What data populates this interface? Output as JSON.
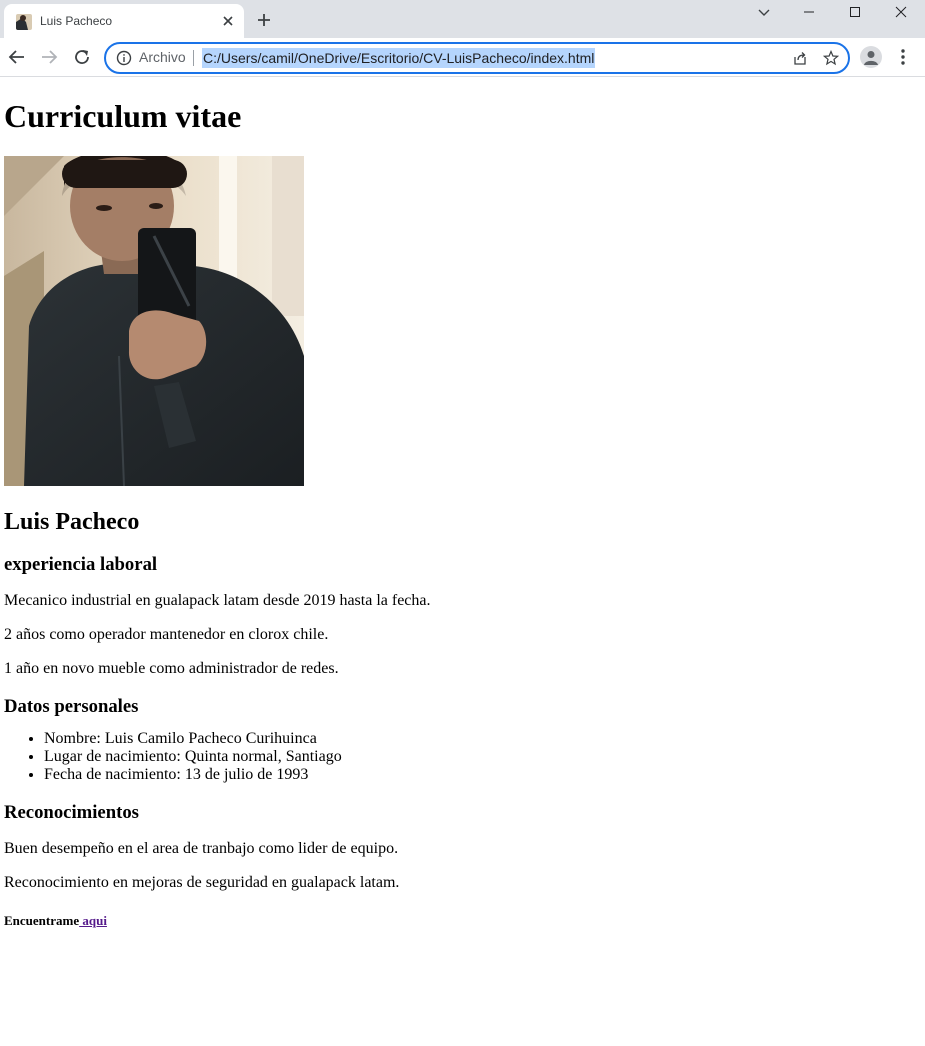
{
  "browser": {
    "tab_title": "Luis Pacheco",
    "address_scheme": "Archivo",
    "address_url": "C:/Users/camil/OneDrive/Escritorio/CV-LuisPacheco/index.html"
  },
  "page": {
    "heading": "Curriculum vitae",
    "name": "Luis Pacheco",
    "experience_heading": "experiencia laboral",
    "experience": [
      "Mecanico industrial en gualapack latam desde 2019 hasta la fecha.",
      "2 años como operador mantenedor en clorox chile.",
      "1 año en novo mueble como administrador de redes."
    ],
    "personal_heading": "Datos personales",
    "personal": [
      "Nombre: Luis Camilo Pacheco Curihuinca",
      "Lugar de nacimiento: Quinta normal, Santiago",
      "Fecha de nacimiento: 13 de julio de 1993"
    ],
    "recognition_heading": "Reconocimientos",
    "recognitions": [
      "Buen desempeño en el area de tranbajo como lider de equipo.",
      "Reconocimiento en mejoras de seguridad en gualapack latam."
    ],
    "find_me_text": "Encuentrame",
    "find_me_link": " aqui"
  },
  "colors": {
    "accent": "#1a73e8",
    "link_visited": "#551a8b",
    "tabstrip": "#dee1e6"
  },
  "icons": [
    "favicon-photo-icon",
    "close-icon",
    "plus-icon",
    "chevron-down-icon",
    "minimize-icon",
    "maximize-icon",
    "window-close-icon",
    "back-arrow-icon",
    "forward-arrow-icon",
    "reload-icon",
    "info-icon",
    "share-icon",
    "star-icon",
    "profile-icon",
    "more-vert-icon"
  ]
}
